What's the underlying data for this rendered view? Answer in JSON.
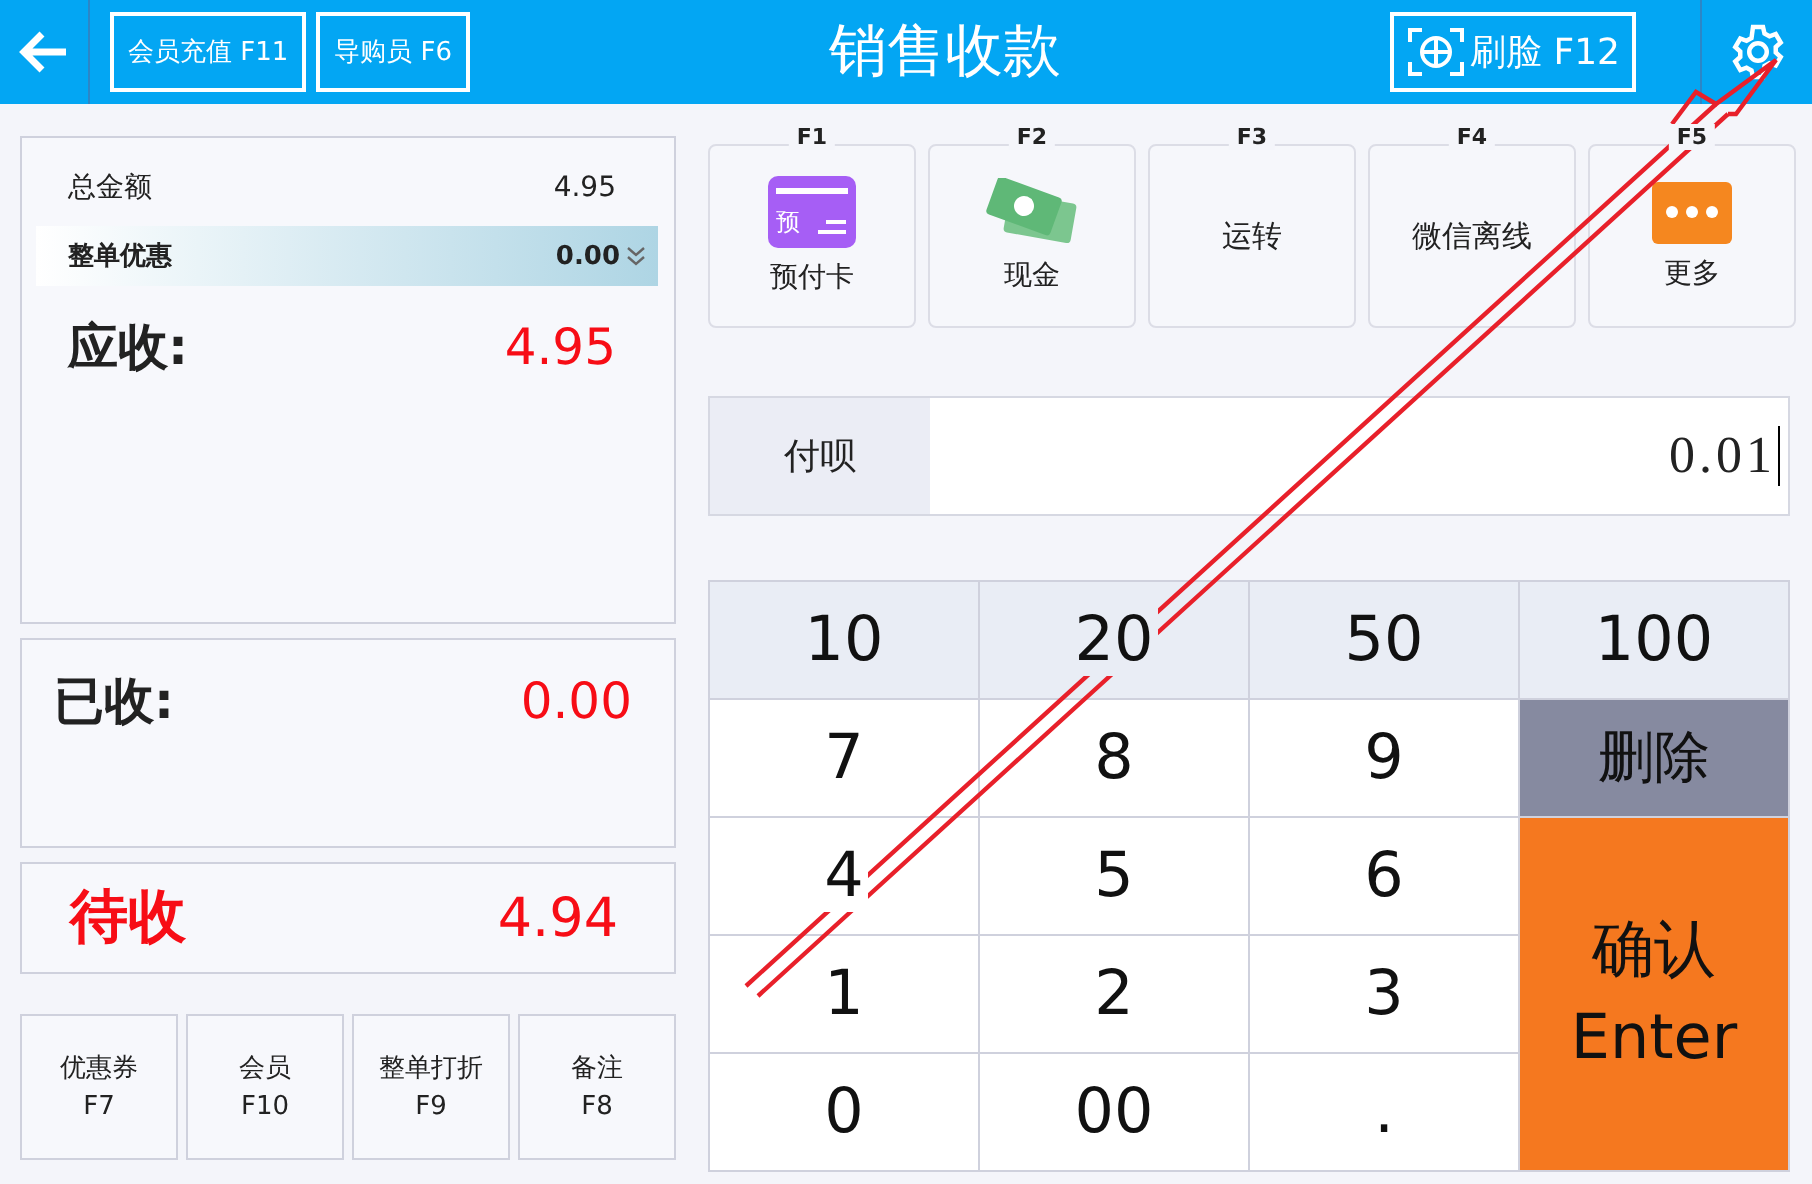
{
  "top_bar": {
    "title": "销售收款",
    "buttons": [
      {
        "label": "会员充值 F11"
      },
      {
        "label": "导购员 F6"
      }
    ],
    "face_button": "刷脸 F12"
  },
  "summary": {
    "total_label": "总金额",
    "total": "4.95",
    "discount_label": "整单优惠",
    "discount": "0.00",
    "receivable_label": "应收:",
    "receivable": "4.95",
    "received_label": "已收:",
    "received": "0.00",
    "pending_label": "待收",
    "pending": "4.94"
  },
  "actions": [
    {
      "label": "优惠券",
      "key": "F7"
    },
    {
      "label": "会员",
      "key": "F10"
    },
    {
      "label": "整单打折",
      "key": "F9"
    },
    {
      "label": "备注",
      "key": "F8"
    }
  ],
  "payment_methods": [
    {
      "key": "F1",
      "label": "预付卡",
      "kind": "card",
      "icon_text": "预"
    },
    {
      "key": "F2",
      "label": "现金",
      "kind": "cash"
    },
    {
      "key": "F3",
      "label": "运转",
      "kind": "text"
    },
    {
      "key": "F4",
      "label": "微信离线",
      "kind": "text"
    },
    {
      "key": "F5",
      "label": "更多",
      "kind": "more"
    }
  ],
  "payment_field": {
    "label": "付呗",
    "value": "0.01"
  },
  "keypad": [
    {
      "label": "10",
      "kind": "amount"
    },
    {
      "label": "20",
      "kind": "amount"
    },
    {
      "label": "50",
      "kind": "amount"
    },
    {
      "label": "100",
      "kind": "amount"
    },
    {
      "label": "7",
      "kind": "digit"
    },
    {
      "label": "8",
      "kind": "digit"
    },
    {
      "label": "9",
      "kind": "digit"
    },
    {
      "label": "删除",
      "kind": "delete"
    },
    {
      "label": "4",
      "kind": "digit"
    },
    {
      "label": "5",
      "kind": "digit"
    },
    {
      "label": "6",
      "kind": "digit"
    },
    {
      "label": "1",
      "kind": "digit"
    },
    {
      "label": "2",
      "kind": "digit"
    },
    {
      "label": "3",
      "kind": "digit"
    },
    {
      "label": "确认",
      "sublabel": "Enter",
      "kind": "confirm"
    },
    {
      "label": "0",
      "kind": "digit"
    },
    {
      "label": "00",
      "kind": "digit"
    },
    {
      "label": ".",
      "kind": "digit"
    }
  ]
}
